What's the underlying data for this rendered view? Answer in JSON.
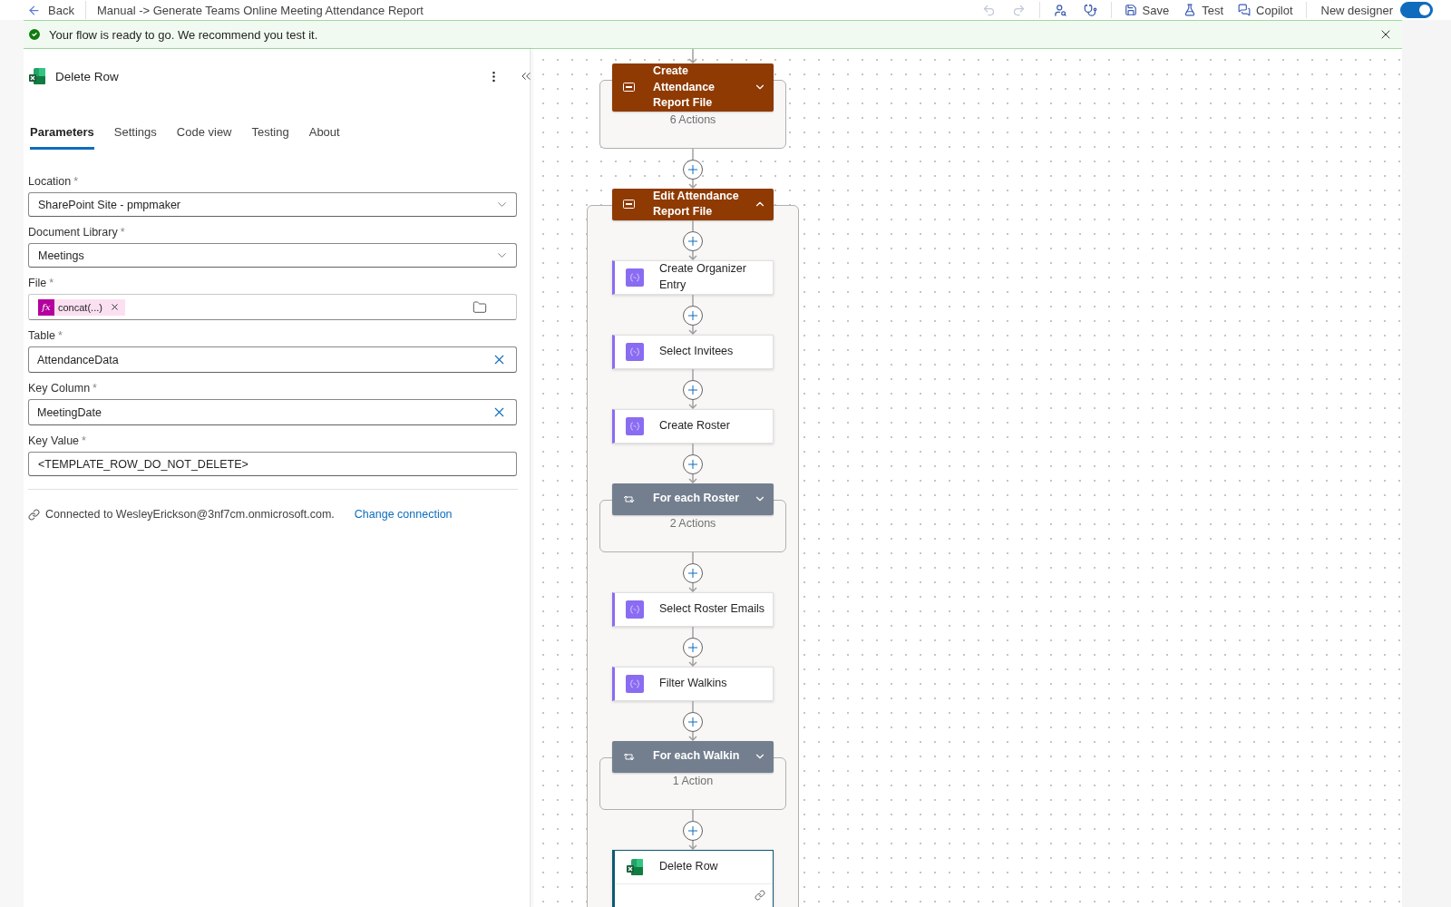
{
  "header": {
    "back": "Back",
    "title": "Manual -> Generate Teams Online Meeting Attendance Report",
    "actions": [
      {
        "kind": "save",
        "label": "Save"
      },
      {
        "kind": "test",
        "label": "Test"
      },
      {
        "kind": "copilot",
        "label": "Copilot"
      }
    ],
    "new_designer": {
      "label": "New designer",
      "on": true
    }
  },
  "banner": {
    "message": "Your flow is ready to go. We recommend you test it."
  },
  "panel": {
    "title": "Delete Row",
    "tabs": [
      {
        "label": "Parameters",
        "selected": true
      },
      {
        "label": "Settings",
        "selected": false
      },
      {
        "label": "Code view",
        "selected": false
      },
      {
        "label": "Testing",
        "selected": false
      },
      {
        "label": "About",
        "selected": false
      }
    ],
    "fields": [
      {
        "kind": "dropdown",
        "label": "Location",
        "mark": "*",
        "value": "SharePoint Site - pmpmaker"
      },
      {
        "kind": "dropdown",
        "label": "Document Library",
        "mark": "*",
        "value": "Meetings"
      },
      {
        "kind": "file",
        "label": "File",
        "mark": "*",
        "token_icon": "fx",
        "token": "concat(...)"
      },
      {
        "kind": "clearable",
        "label": "Table",
        "mark": "*",
        "value": "AttendanceData"
      },
      {
        "kind": "clearable",
        "label": "Key Column",
        "mark": "*",
        "value": "MeetingDate"
      },
      {
        "kind": "text",
        "label": "Key Value",
        "mark": "*",
        "value": "<TEMPLATE_ROW_DO_NOT_DELETE>"
      }
    ],
    "connection": {
      "text": "Connected to WesleyErickson@3nf7cm.onmicrosoft.com.",
      "link": "Change connection"
    }
  },
  "flow": {
    "nodes": [
      {
        "kind": "scope",
        "title": "Create Attendance Report File",
        "expanded": false,
        "summary": "6 Actions"
      },
      {
        "kind": "scope",
        "title": "Edit Attendance Report File",
        "expanded": true,
        "children": [
          {
            "kind": "action",
            "title": "Create Organizer Entry",
            "selected": false
          },
          {
            "kind": "action",
            "title": "Select Invitees",
            "selected": false
          },
          {
            "kind": "action",
            "title": "Create Roster",
            "selected": false
          },
          {
            "kind": "loop",
            "title": "For each Roster",
            "expanded": false,
            "summary": "2 Actions"
          },
          {
            "kind": "action",
            "title": "Select Roster Emails",
            "selected": false
          },
          {
            "kind": "action",
            "title": "Filter Walkins",
            "selected": false
          },
          {
            "kind": "loop",
            "title": "For each Walkin",
            "expanded": false,
            "summary": "1 Action"
          },
          {
            "kind": "excel",
            "title": "Delete Row",
            "selected": true
          }
        ]
      }
    ]
  }
}
